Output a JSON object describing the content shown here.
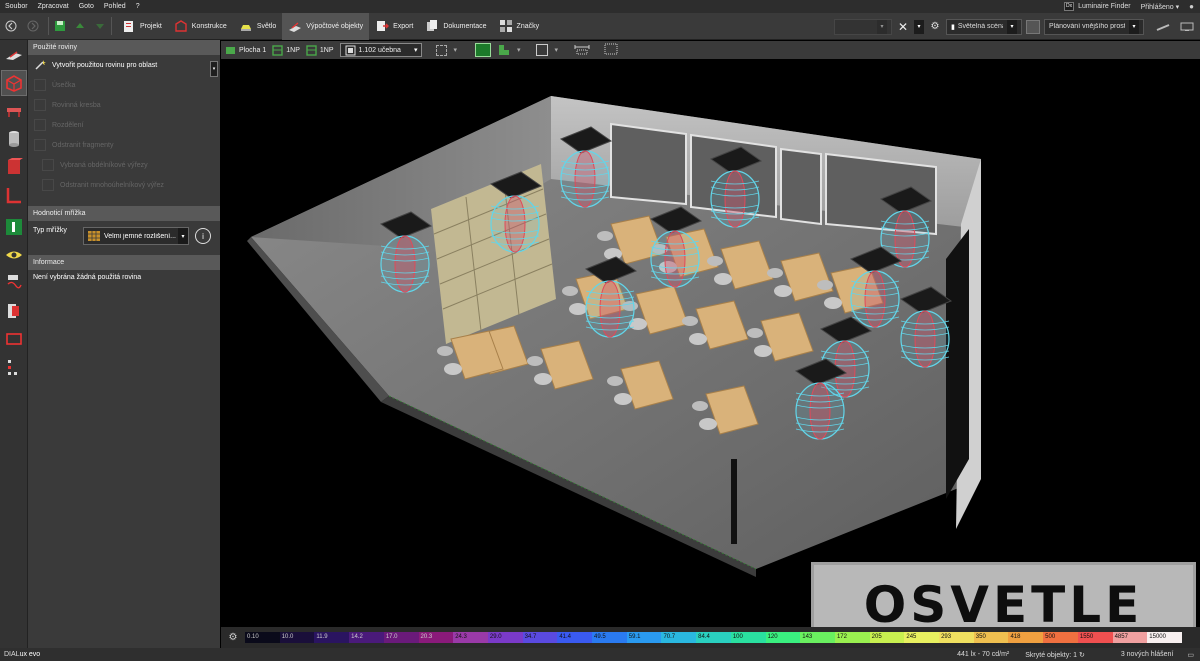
{
  "menu": [
    "Soubor",
    "Zpracovat",
    "Goto",
    "Pohled",
    "?"
  ],
  "luminaire_finder": "Luminaire Finder",
  "luminaire_finder_logo": "Dx",
  "login": "Přihlášeno",
  "ribbon": [
    {
      "label": "Projekt",
      "icon": "project-icon"
    },
    {
      "label": "Konstrukce",
      "icon": "construction-icon"
    },
    {
      "label": "Světlo",
      "icon": "light-icon"
    },
    {
      "label": "Výpočtové objekty",
      "icon": "calc-objects-icon",
      "active": true
    },
    {
      "label": "Export",
      "icon": "export-icon"
    },
    {
      "label": "Dokumentace",
      "icon": "documentation-icon"
    },
    {
      "label": "Značky",
      "icon": "markers-icon"
    }
  ],
  "toolbar_right": {
    "light_scene": "Světelná scéna 1",
    "planning": "Plánování vnějšího prost..."
  },
  "left_panel": {
    "section1_title": "Použité roviny",
    "items": [
      {
        "label": "Vytvořit použitou rovinu pro oblast",
        "disabled": false
      },
      {
        "label": "Úsečka",
        "disabled": true
      },
      {
        "label": "Rovinná kresba",
        "disabled": true
      },
      {
        "label": "Rozdělení",
        "disabled": true
      },
      {
        "label": "Odstranit fragmenty",
        "disabled": true
      },
      {
        "label": "Vybraná obdélníkové výřezy",
        "disabled": true
      },
      {
        "label": "Odstranit mnohoúhelníkový výřez",
        "disabled": true
      }
    ],
    "section2_title": "Hodnoticí mřížka",
    "grid_type_label": "Typ mřížky",
    "grid_type_value": "Velmi jemné rozlišení...",
    "section3_title": "Informace",
    "info_text": "Není vybrána žádná použitá rovina"
  },
  "viewport_toolbar": {
    "area": "Plocha 1",
    "floor1": "1NP",
    "floor2": "1NP",
    "room": "1.102 učebna"
  },
  "watermark": "OSVETLE",
  "scale": {
    "values": [
      "0.10",
      "10.0",
      "11.9",
      "14.2",
      "17.0",
      "20.3",
      "24.3",
      "29.0",
      "34.7",
      "41.4",
      "49.5",
      "59.1",
      "70.7",
      "84.4",
      "100",
      "120",
      "143",
      "172",
      "205",
      "245",
      "293",
      "350",
      "418",
      "500",
      "1550",
      "4857",
      "15000"
    ],
    "colors": [
      "#0a0a1a",
      "#1a0f3a",
      "#2a1460",
      "#4a1a7a",
      "#6a1a7a",
      "#8a1a7a",
      "#9a3aa8",
      "#7a3ac8",
      "#5a4ae0",
      "#3a5af0",
      "#2a7af0",
      "#2a9af0",
      "#2ab8e0",
      "#2ad0c0",
      "#2ae0a0",
      "#3af080",
      "#6af060",
      "#9af050",
      "#c8f050",
      "#e8f060",
      "#f0e060",
      "#f0c050",
      "#f0a040",
      "#f07040",
      "#f05050",
      "#f0a0a0",
      "#f8f0f0"
    ]
  },
  "status": {
    "logo_prefix": "DIAL",
    "logo_name": "ux evo",
    "measure": "441 lx - 70 cd/m²",
    "hidden_objects": "Skryté objekty: 1",
    "messages": "3 nových hlášení"
  }
}
